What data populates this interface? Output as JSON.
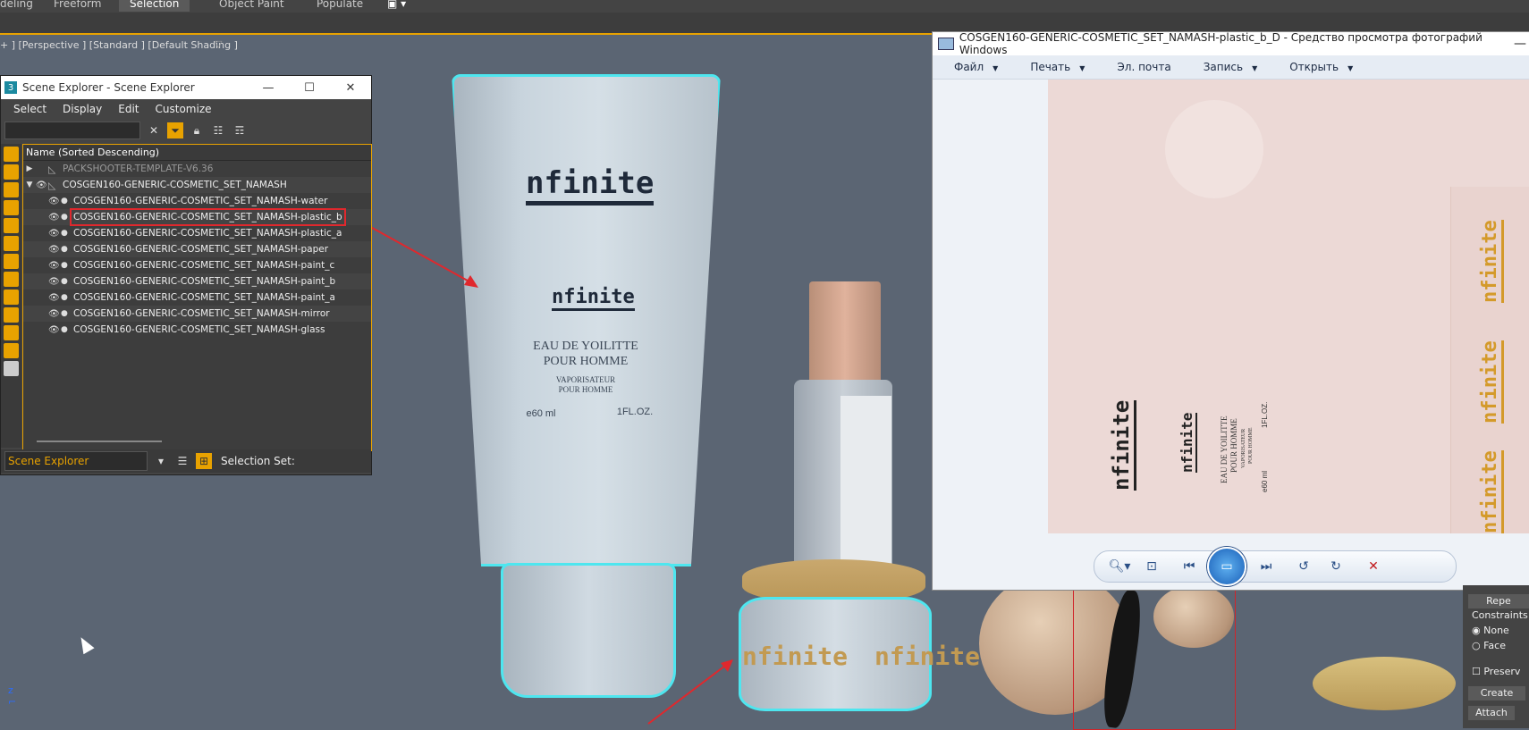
{
  "ribbon": {
    "tabs": [
      "deling",
      "Freeform",
      "Selection",
      "Object Paint",
      "Populate"
    ],
    "active_tab": "Selection"
  },
  "viewport": {
    "label": "+ ] [Perspective ] [Standard ] [Default Shading ]",
    "filter_icon": "funnel-icon"
  },
  "scene_explorer": {
    "title": "Scene Explorer - Scene Explorer",
    "app_icon_text": "3",
    "menu": [
      "Select",
      "Display",
      "Edit",
      "Customize"
    ],
    "column_header": "Name (Sorted Descending)",
    "rows": [
      {
        "name": "PACKSHOOTER-TEMPLATE-V6.36",
        "dim": true
      },
      {
        "name": "COSGEN160-GENERIC-COSMETIC_SET_NAMASH"
      },
      {
        "name": "COSGEN160-GENERIC-COSMETIC_SET_NAMASH-water"
      },
      {
        "name": "COSGEN160-GENERIC-COSMETIC_SET_NAMASH-plastic_b",
        "selected": true
      },
      {
        "name": "COSGEN160-GENERIC-COSMETIC_SET_NAMASH-plastic_a"
      },
      {
        "name": "COSGEN160-GENERIC-COSMETIC_SET_NAMASH-paper"
      },
      {
        "name": "COSGEN160-GENERIC-COSMETIC_SET_NAMASH-paint_c"
      },
      {
        "name": "COSGEN160-GENERIC-COSMETIC_SET_NAMASH-paint_b"
      },
      {
        "name": "COSGEN160-GENERIC-COSMETIC_SET_NAMASH-paint_a"
      },
      {
        "name": "COSGEN160-GENERIC-COSMETIC_SET_NAMASH-mirror"
      },
      {
        "name": "COSGEN160-GENERIC-COSMETIC_SET_NAMASH-glass"
      }
    ],
    "explorer_dropdown": "Scene Explorer",
    "selection_set_label": "Selection Set:",
    "accent": "#e8a200"
  },
  "product": {
    "logo": "nfinite",
    "line1": "EAU DE YOILITTE",
    "line2": "POUR HOMME",
    "line3": "VAPORISATEUR",
    "line4": "POUR HOMME",
    "volume": "e60 ml",
    "oz": "1FL.OZ.",
    "jar_logo": "nfinite"
  },
  "photo_viewer": {
    "title": "COSGEN160-GENERIC-COSMETIC_SET_NAMASH-plastic_b_D - Средство просмотра фотографий Windows",
    "menu": [
      "Файл",
      "Печать",
      "Эл. почта",
      "Запись",
      "Открыть"
    ],
    "menu_has_arrow": [
      true,
      true,
      false,
      true,
      true
    ],
    "tex_logo": "nfinite",
    "tex_line1": "EAU DE YOILITTE",
    "tex_line2": "POUR HOMME",
    "tex_line3": "VAPORISATEUR",
    "tex_line4": "POUR HOMME",
    "tex_vol": "e60 ml",
    "tex_oz": "1FL.OZ."
  },
  "right_panel": {
    "repeat": "Repe",
    "constraints": "Constraints",
    "none": "None",
    "face": "Face",
    "preserve": "Preserv",
    "create": "Create",
    "attach": "Attach"
  }
}
